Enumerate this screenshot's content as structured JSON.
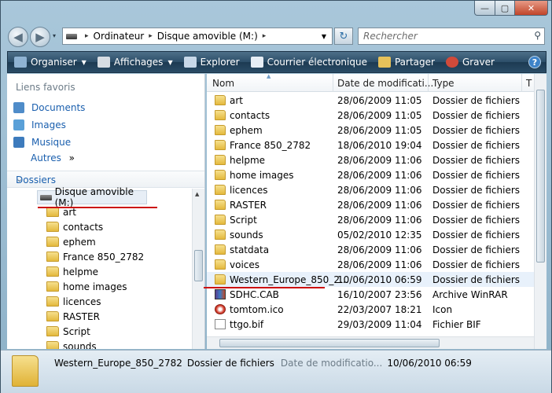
{
  "titlebar": {
    "min_glyph": "—",
    "max_glyph": "▢",
    "close_glyph": "✕"
  },
  "nav": {
    "back_glyph": "◀",
    "forward_glyph": "▶",
    "history_glyph": "▾",
    "address_root_glyph": "▸",
    "address_parts": [
      "Ordinateur",
      "Disque amovible (M:)"
    ],
    "address_sep_glyph": "▸",
    "address_drop_glyph": "▼",
    "refresh_glyph": "↻",
    "search_placeholder": "Rechercher",
    "search_icon_glyph": "⚲"
  },
  "toolbar": {
    "items": [
      {
        "label": "Organiser",
        "icon": "organize-icon",
        "color": "#8fb3d3",
        "has_arrow": true
      },
      {
        "label": "Affichages",
        "icon": "views-icon",
        "color": "#d7dde3",
        "has_arrow": true
      },
      {
        "label": "Explorer",
        "icon": "explore-icon",
        "color": "#c8d8e8",
        "has_arrow": false
      },
      {
        "label": "Courrier électronique",
        "icon": "email-icon",
        "color": "#e7eef5",
        "has_arrow": false
      },
      {
        "label": "Partager",
        "icon": "share-icon",
        "color": "#e6c15a",
        "has_arrow": false
      },
      {
        "label": "Graver",
        "icon": "burn-icon",
        "color": "#d14a3a",
        "has_arrow": false
      }
    ],
    "arrow_glyph": "▼",
    "help_glyph": "?"
  },
  "sidebar": {
    "favorites_title": "Liens favoris",
    "favorites": [
      {
        "label": "Documents",
        "color": "#4f8cc9"
      },
      {
        "label": "Images",
        "color": "#5aa0d8"
      },
      {
        "label": "Musique",
        "color": "#3d7bbd"
      }
    ],
    "more_label": "Autres",
    "more_glyph": "»",
    "folders_title": "Dossiers",
    "folders_chevron": "⌄",
    "tree_root": "Disque amovible (M:)",
    "tree_items": [
      "art",
      "contacts",
      "ephem",
      "France 850_2782",
      "helpme",
      "home images",
      "licences",
      "RASTER",
      "Script",
      "sounds"
    ],
    "scroll_up_glyph": "▲"
  },
  "list": {
    "columns": {
      "name": "Nom",
      "date": "Date de modificati...",
      "type": "Type",
      "extra": "T"
    },
    "sort_glyph": "▲",
    "rows": [
      {
        "name": "art",
        "date": "28/06/2009 11:05",
        "type": "Dossier de fichiers",
        "kind": "folder"
      },
      {
        "name": "contacts",
        "date": "28/06/2009 11:05",
        "type": "Dossier de fichiers",
        "kind": "folder"
      },
      {
        "name": "ephem",
        "date": "28/06/2009 11:05",
        "type": "Dossier de fichiers",
        "kind": "folder"
      },
      {
        "name": "France 850_2782",
        "date": "18/06/2010 19:04",
        "type": "Dossier de fichiers",
        "kind": "folder"
      },
      {
        "name": "helpme",
        "date": "28/06/2009 11:06",
        "type": "Dossier de fichiers",
        "kind": "folder"
      },
      {
        "name": "home images",
        "date": "28/06/2009 11:06",
        "type": "Dossier de fichiers",
        "kind": "folder"
      },
      {
        "name": "licences",
        "date": "28/06/2009 11:06",
        "type": "Dossier de fichiers",
        "kind": "folder"
      },
      {
        "name": "RASTER",
        "date": "28/06/2009 11:06",
        "type": "Dossier de fichiers",
        "kind": "folder"
      },
      {
        "name": "Script",
        "date": "28/06/2009 11:06",
        "type": "Dossier de fichiers",
        "kind": "folder"
      },
      {
        "name": "sounds",
        "date": "05/02/2010 12:35",
        "type": "Dossier de fichiers",
        "kind": "folder"
      },
      {
        "name": "statdata",
        "date": "28/06/2009 11:06",
        "type": "Dossier de fichiers",
        "kind": "folder"
      },
      {
        "name": "voices",
        "date": "28/06/2009 11:06",
        "type": "Dossier de fichiers",
        "kind": "folder"
      },
      {
        "name": "Western_Europe_850_2...",
        "date": "10/06/2010 06:59",
        "type": "Dossier de fichiers",
        "kind": "folder"
      },
      {
        "name": "SDHC.CAB",
        "date": "16/10/2007 23:56",
        "type": "Archive WinRAR",
        "kind": "archive"
      },
      {
        "name": "tomtom.ico",
        "date": "22/03/2007 18:21",
        "type": "Icon",
        "kind": "icon"
      },
      {
        "name": "ttgo.bif",
        "date": "29/03/2009 11:04",
        "type": "Fichier BIF",
        "kind": "file"
      }
    ],
    "selected_index": 12
  },
  "details": {
    "name": "Western_Europe_850_2782",
    "type": "Dossier de fichiers",
    "date_label": "Date de modificatio...",
    "date_value": "10/06/2010 06:59"
  },
  "colors": {
    "link": "#1a5fae",
    "annotation": "#cc1111",
    "selection": "#e8f1fb"
  }
}
